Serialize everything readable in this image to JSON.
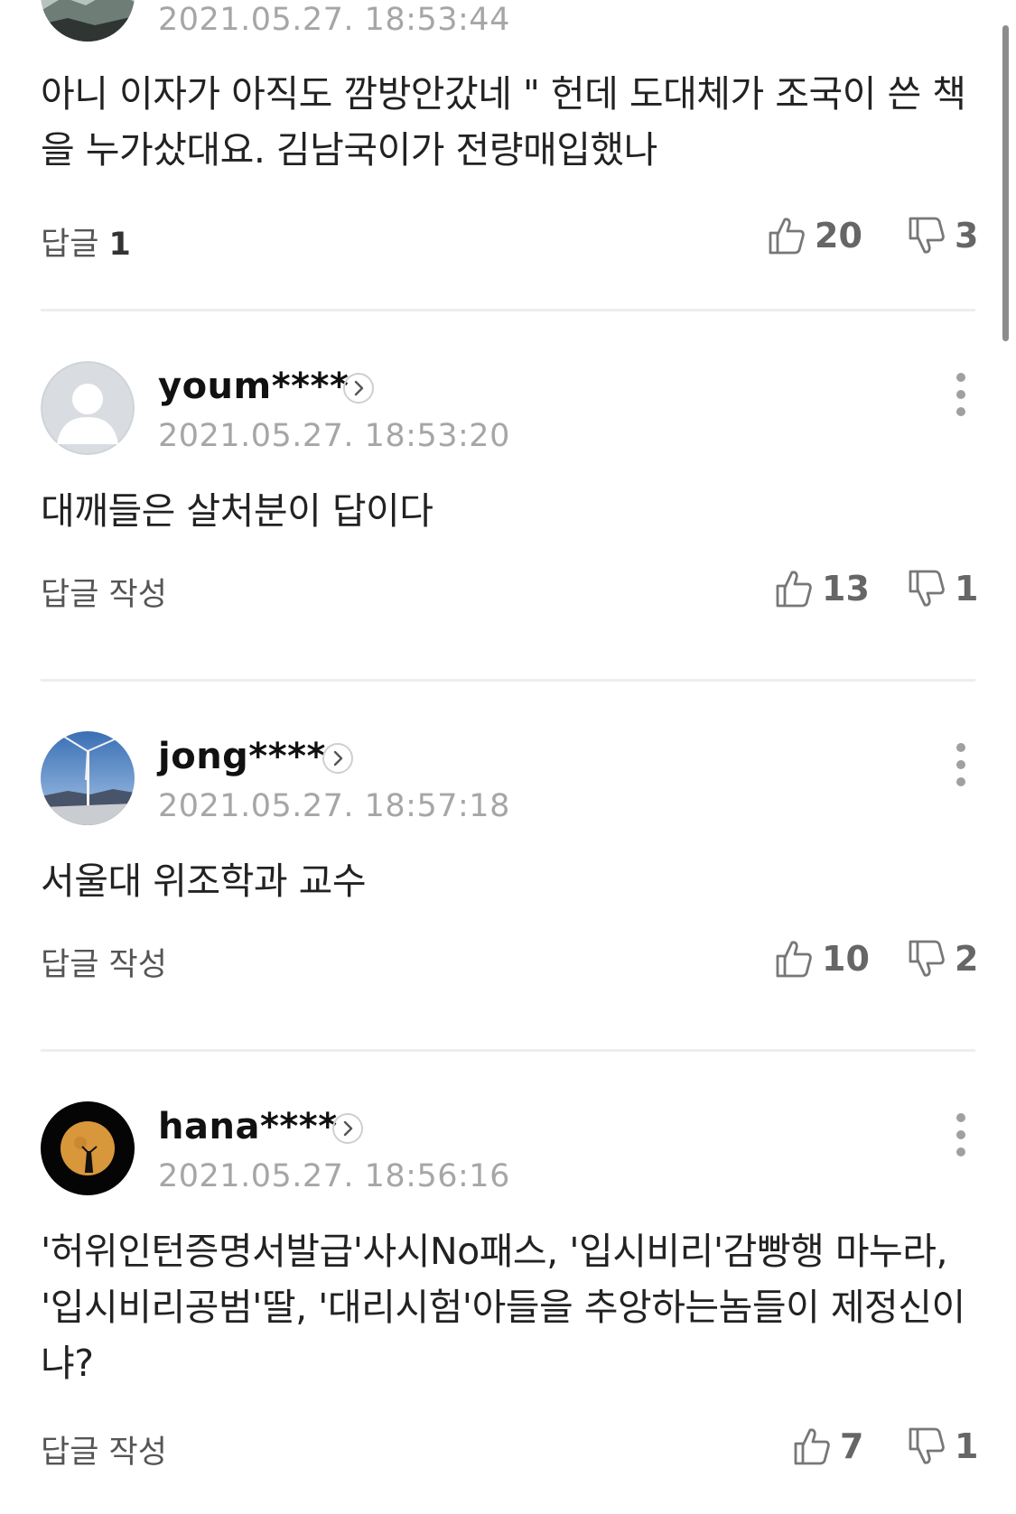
{
  "comments": [
    {
      "username": "",
      "timestamp": "2021.05.27. 18:53:44",
      "text": "아니 이자가 아직도 깜방안갔네 \" 헌데 도대체가 조국이 쓴 책을 누가샀대요. 김남국이가 전량매입했나",
      "reply_label": "답글",
      "reply_count": "1",
      "likes": "20",
      "dislikes": "3",
      "avatar": "landscape-photo"
    },
    {
      "username": "youm****",
      "timestamp": "2021.05.27. 18:53:20",
      "text": "대깨들은 살처분이 답이다",
      "reply_label": "답글 작성",
      "likes": "13",
      "dislikes": "1",
      "avatar": "default-user-silhouette"
    },
    {
      "username": "jong****",
      "timestamp": "2021.05.27. 18:57:18",
      "text": "서울대 위조학과 교수",
      "reply_label": "답글 작성",
      "likes": "10",
      "dislikes": "2",
      "avatar": "wind-turbine-photo"
    },
    {
      "username": "hana****",
      "timestamp": "2021.05.27. 18:56:16",
      "text": "'허위인턴증명서발급'사시No패스, '입시비리'감빵행 마누라, '입시비리공범'딸, '대리시험'아들을 추앙하는놈들이 제정신이냐?",
      "reply_label": "답글 작성",
      "likes": "7",
      "dislikes": "1",
      "avatar": "moon-silhouette-photo"
    }
  ],
  "icons": {
    "like": "thumbs-up-icon",
    "dislike": "thumbs-down-icon",
    "more": "more-vertical-icon",
    "profile": "chevron-right-icon"
  },
  "colors": {
    "timestamp": "#a6a6a6",
    "divider": "#eeeeee",
    "text": "#222222"
  }
}
